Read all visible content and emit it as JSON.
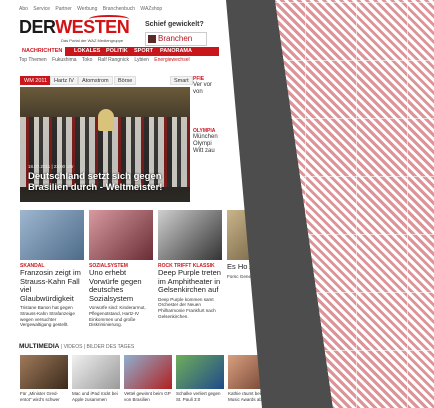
{
  "util_links": [
    "Abo",
    "Service",
    "Partner",
    "Werbung",
    "Branchenbuch",
    "WAZshop"
  ],
  "logo": {
    "part1": "DER",
    "part2": "WESTEN",
    "tagline": "Das Portal der WAZ Mediengruppe"
  },
  "promo": {
    "text": "Schief gewickelt?",
    "button": "Branchen"
  },
  "nav": {
    "items": [
      "NACHRICHTEN",
      "LOKALES",
      "POLITIK",
      "SPORT",
      "PANORAMA"
    ],
    "active_index": 0
  },
  "subnav": {
    "items": [
      "Top Themen",
      "Fukushima",
      "Toko",
      "Ralf Rangnick",
      "Lybien"
    ],
    "highlight": "Energiewechsel"
  },
  "tabs": [
    "WM 2011",
    "Hartz IV",
    "Atomstrom",
    "Börse",
    "Smart"
  ],
  "hero": {
    "meta": "18.07.2011 | 23:00 Uhr",
    "headline": "Deutschland setzt sich gegen Brasilien durch - Weltmeister!"
  },
  "side": {
    "label1": "PFIE",
    "txt1": "Ver vor von",
    "label2": "OLYMPIA",
    "txt2": "München Olympi Witt zau"
  },
  "teasers": [
    {
      "kicker": "SKANDAL",
      "title": "Franzosin zeigt im Strauss-Kahn Fall viel Glaubwürdigkeit",
      "body": "Tristane Banon hat gegen Strauss-Kahn Strafanzeige wegen versuchter Vergewaltigung gestellt."
    },
    {
      "kicker": "SOZIALSYSTEM",
      "title": "Uno erhebt Vorwürfe gegen deutsches Sozialsystem",
      "body": "Vorwürfe sind: Kinderarmut, Pflegenotstand, Hartz-IV Einkommen und große Diskriminierung."
    },
    {
      "kicker": "ROCK TRIFFT KLASSIK",
      "title": "Deep Purple treten im Amphitheater in Gelsenkirchen auf",
      "body": "Deep Purple kommen samt Orchester der Neuen Philharmonie Frankfurt nach Gelsenkirchen."
    },
    {
      "kicker": "",
      "title": "Es Ho Alz",
      "body": "Forsc Gene wesen von A"
    }
  ],
  "multimedia": {
    "title": "MULTIMEDIA",
    "sub": "| VIDEOS | BILDER DES TAGES",
    "items": [
      "Für „Minister Gred-entot“ wird's schwer",
      "Mac und iPad rückt bei Apple zusammen",
      "Vettel gewinnt beim GP von Brasilien",
      "Schalke verliert gegen St. Pauli 3:0",
      "Kathie räumt bei den Music Awards ab"
    ]
  },
  "colors": {
    "brand_red": "#c8161d",
    "overlay_gray": "#4d4d4d",
    "stripe_red": "#b3121a"
  }
}
